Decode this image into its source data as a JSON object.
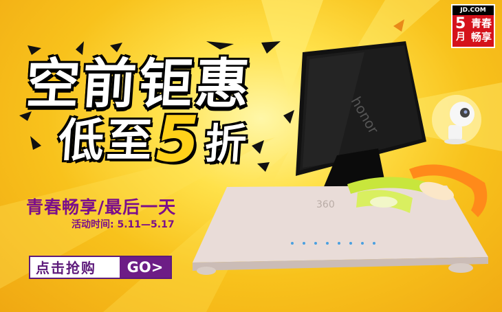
{
  "badge": {
    "site": "JD.COM",
    "number": "5",
    "month": "月",
    "line1": "青春",
    "line2": "畅享"
  },
  "headline": {
    "line1": "空前钜惠",
    "line2_a": "低至",
    "line2_b": "5",
    "line2_c": "折"
  },
  "subtitle": "青春畅享/最后一天",
  "date_range": "活动时间: 5.11—5.17",
  "cta": {
    "label": "点击抢购",
    "go": "GO>"
  },
  "products": {
    "router_brand": "360",
    "tablet_brand": "honor"
  },
  "colors": {
    "background": "#f8c21c",
    "accent_purple": "#6d1d86",
    "jd_red": "#d5121b",
    "band_lime": "#c8e63c",
    "band_orange": "#ff8a1a"
  }
}
